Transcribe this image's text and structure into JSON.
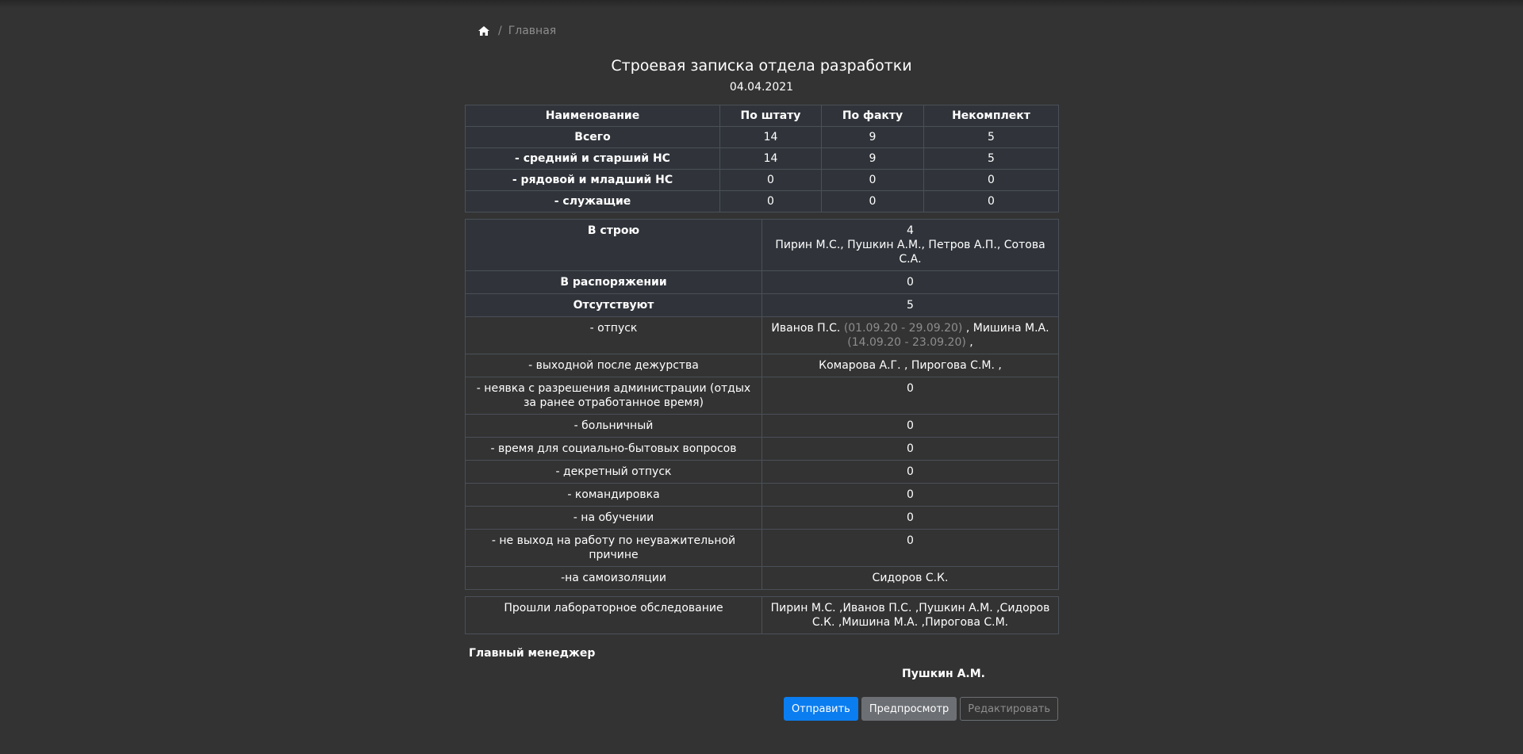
{
  "breadcrumb": {
    "home_icon": "home-icon",
    "separator": "/",
    "current": "Главная"
  },
  "header": {
    "title": "Строевая записка отдела разработки",
    "date": "04.04.2021"
  },
  "staff_table": {
    "headers": [
      "Наименование",
      "По штату",
      "По факту",
      "Некомплект"
    ],
    "rows": [
      {
        "name": "Всего",
        "state": "14",
        "fact": "9",
        "shortage": "5"
      },
      {
        "name": "- средний и старший НС",
        "state": "14",
        "fact": "9",
        "shortage": "5"
      },
      {
        "name": "- рядовой и младший НС",
        "state": "0",
        "fact": "0",
        "shortage": "0"
      },
      {
        "name": "- служащие",
        "state": "0",
        "fact": "0",
        "shortage": "0"
      }
    ]
  },
  "presence_table": {
    "in_line": {
      "label": "В строю",
      "count": "4",
      "names": "Пирин М.С., Пушкин А.М., Петров А.П., Сотова С.А."
    },
    "at_disposal": {
      "label": "В распоряжении",
      "value": "0"
    },
    "absent": {
      "label": "Отсутствуют",
      "value": "5"
    },
    "vacation": {
      "label": "- отпуск",
      "name1": "Иванов П.С.",
      "period1": "(01.09.20 - 29.09.20)",
      "name2": ", Мишина М.А.",
      "period2": "(14.09.20 - 23.09.20)",
      "tail": ","
    },
    "rows": [
      {
        "label": "- выходной после дежурства",
        "value": "Комарова А.Г. , Пирогова С.М. ,"
      },
      {
        "label": "- неявка с разрешения администрации (отдых за ранее отработанное время)",
        "value": "0"
      },
      {
        "label": "- больничный",
        "value": "0"
      },
      {
        "label": "- время для социально-бытовых вопросов",
        "value": "0"
      },
      {
        "label": "- декретный отпуск",
        "value": "0"
      },
      {
        "label": "- командировка",
        "value": "0"
      },
      {
        "label": "- на обучении",
        "value": "0"
      },
      {
        "label": "- не выход на работу по неуважительной причине",
        "value": "0"
      },
      {
        "label": "-на самоизоляции",
        "value": "Сидоров С.К."
      }
    ]
  },
  "lab_table": {
    "label": "Прошли лабораторное обследование",
    "value": "Пирин М.С. ,Иванов П.С. ,Пушкин А.М. ,Сидоров С.К. ,Мишина М.А. ,Пирогова С.М."
  },
  "signature": {
    "title": "Главный менеджер",
    "name": "Пушкин А.М."
  },
  "actions": {
    "send": "Отправить",
    "preview": "Предпросмотр",
    "edit": "Редактировать"
  }
}
